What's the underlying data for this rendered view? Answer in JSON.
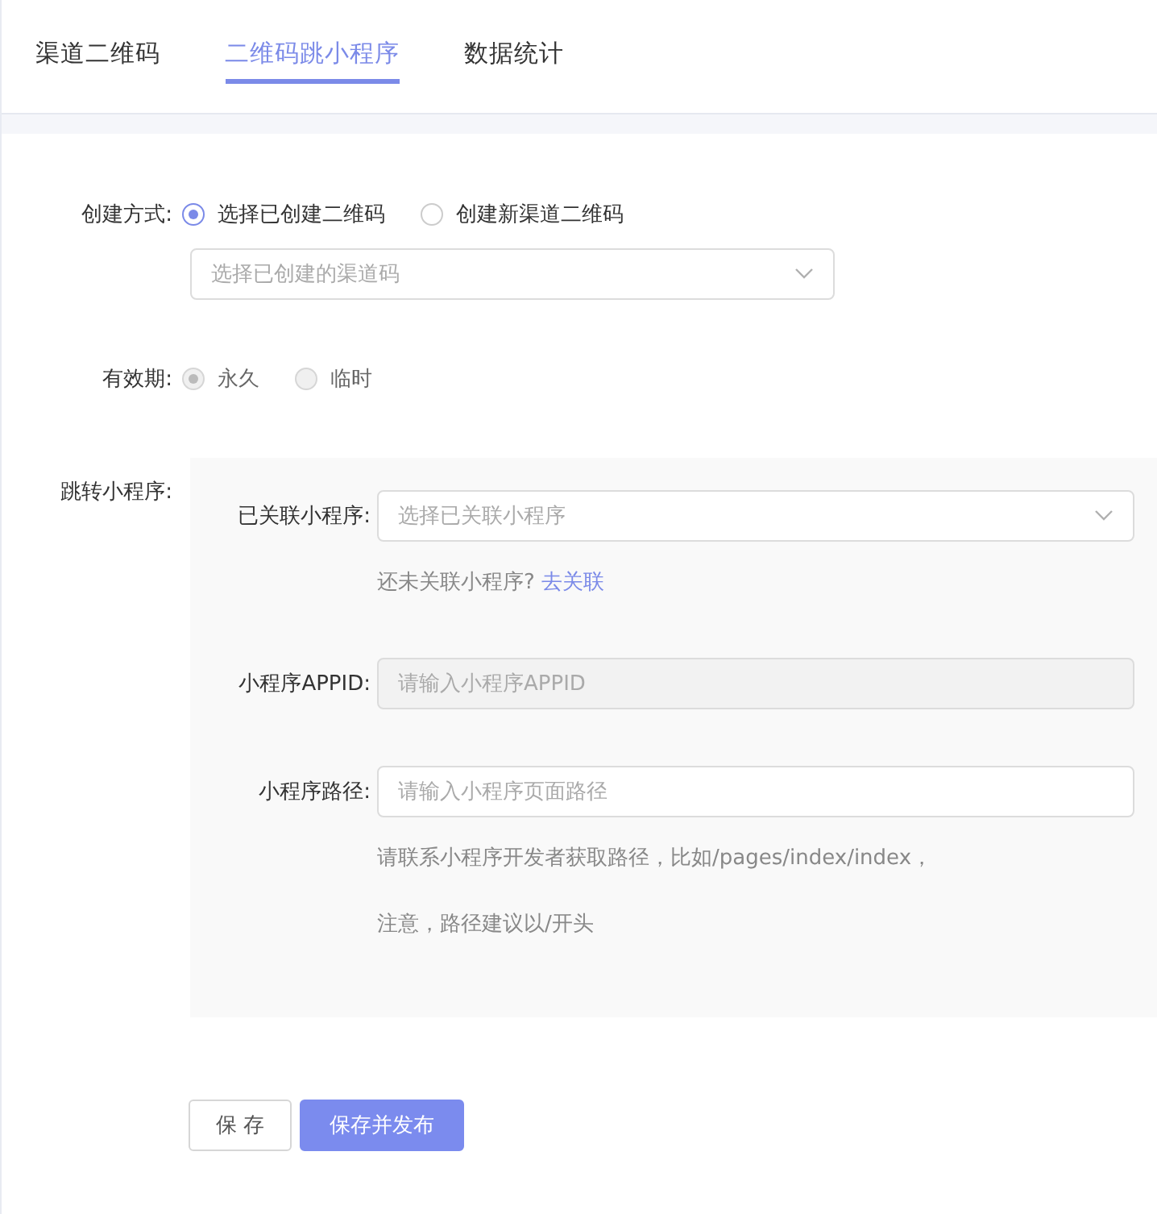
{
  "tabs": [
    {
      "label": "渠道二维码",
      "selected": false
    },
    {
      "label": "二维码跳小程序",
      "selected": true
    },
    {
      "label": "数据统计",
      "selected": false
    }
  ],
  "create_mode": {
    "label": "创建方式:",
    "options": [
      {
        "label": "选择已创建二维码",
        "selected": true,
        "disabled": false
      },
      {
        "label": "创建新渠道二维码",
        "selected": false,
        "disabled": false
      }
    ],
    "select": {
      "placeholder": "选择已创建的渠道码"
    }
  },
  "validity": {
    "label": "有效期:",
    "options": [
      {
        "label": "永久",
        "selected": true,
        "disabled": true
      },
      {
        "label": "临时",
        "selected": false,
        "disabled": true
      }
    ]
  },
  "jump": {
    "label": "跳转小程序:",
    "linked": {
      "label": "已关联小程序:",
      "placeholder": "选择已关联小程序",
      "hint": "还未关联小程序?",
      "link": "去关联"
    },
    "appid": {
      "label": "小程序APPID:",
      "placeholder": "请输入小程序APPID",
      "disabled": true
    },
    "path": {
      "label": "小程序路径:",
      "placeholder": "请输入小程序页面路径",
      "disabled": false,
      "hints": [
        "请联系小程序开发者获取路径，比如/pages/index/index，",
        "注意，路径建议以/开头"
      ]
    }
  },
  "buttons": [
    {
      "label": "保 存",
      "kind": "default"
    },
    {
      "label": "保存并发布",
      "kind": "primary"
    }
  ]
}
